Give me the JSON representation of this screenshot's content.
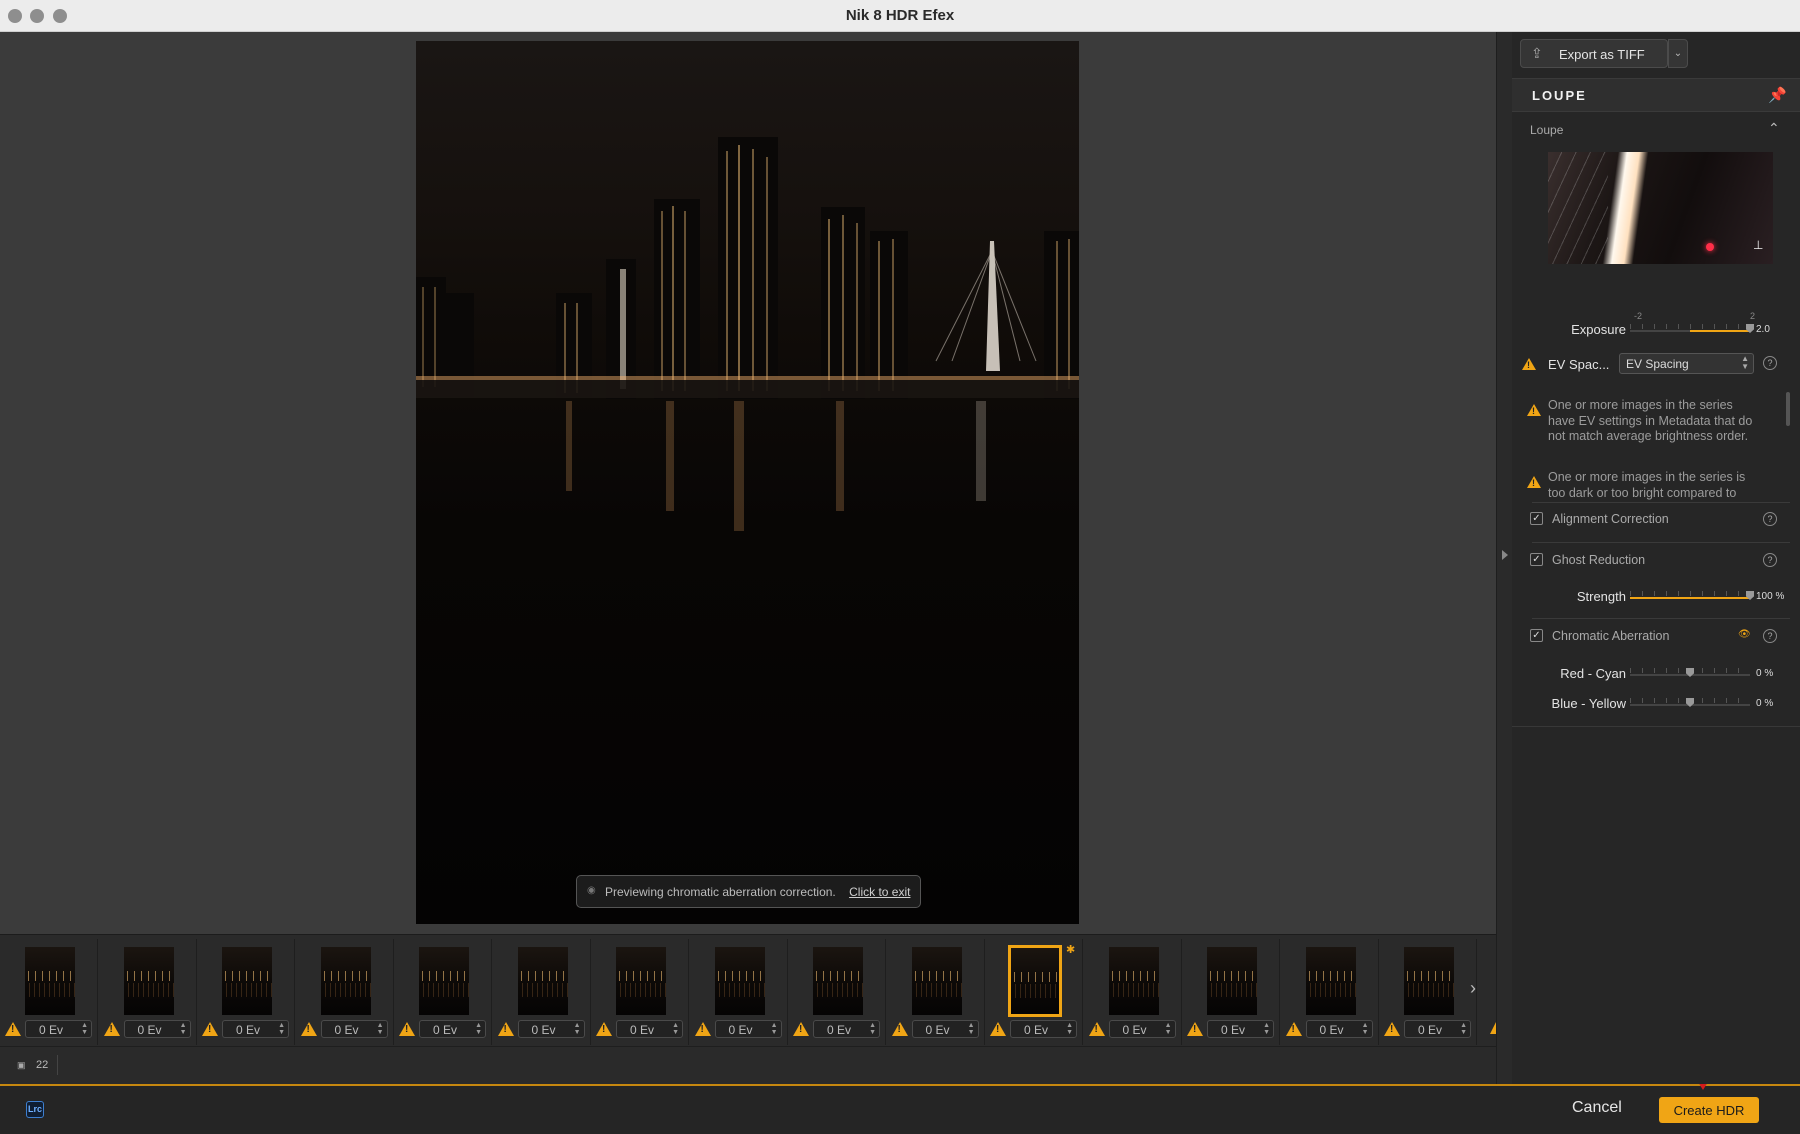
{
  "window": {
    "title": "Nik 8 HDR Efex"
  },
  "preview": {
    "message": "Previewing chromatic aberration correction.",
    "exit_link": "Click to exit"
  },
  "filmstrip": {
    "frames": [
      {
        "ev": "0 Ev"
      },
      {
        "ev": "0 Ev"
      },
      {
        "ev": "0 Ev"
      },
      {
        "ev": "0 Ev"
      },
      {
        "ev": "0 Ev"
      },
      {
        "ev": "0 Ev"
      },
      {
        "ev": "0 Ev"
      },
      {
        "ev": "0 Ev"
      },
      {
        "ev": "0 Ev"
      },
      {
        "ev": "0 Ev"
      },
      {
        "ev": "0 Ev",
        "selected": true
      },
      {
        "ev": "0 Ev"
      },
      {
        "ev": "0 Ev"
      },
      {
        "ev": "0 Ev"
      },
      {
        "ev": "0 Ev"
      }
    ],
    "image_count": "22"
  },
  "bottom": {
    "lrc_badge": "Lrc",
    "cancel_label": "Cancel",
    "create_label": "Create HDR"
  },
  "panel": {
    "export_label": "Export as TIFF",
    "loupe_header": "LOUPE",
    "loupe_sub": "Loupe",
    "exposure": {
      "label": "Exposure",
      "value": "2.0",
      "min_label": "-2",
      "max_label": "2",
      "fraction": 1.0
    },
    "ev_spacing": {
      "label": "EV Spac...",
      "selected": "EV Spacing"
    },
    "messages": [
      "One or more images in the series have EV settings in Metadata that do not match average brightness order.",
      "One or more images in the series is too dark or too bright compared to"
    ],
    "alignment": {
      "label": "Alignment Correction",
      "checked": true
    },
    "ghost": {
      "label": "Ghost Reduction",
      "checked": true
    },
    "strength": {
      "label": "Strength",
      "value": "100 %",
      "fraction": 1.0
    },
    "chromatic": {
      "label": "Chromatic Aberration",
      "checked": true
    },
    "red_cyan": {
      "label": "Red - Cyan",
      "value": "0 %",
      "fraction": 0.5
    },
    "blue_yellow": {
      "label": "Blue - Yellow",
      "value": "0 %",
      "fraction": 0.5
    }
  },
  "colors": {
    "accent": "#f0a515",
    "annotation_arrow": "#d51c1c"
  }
}
